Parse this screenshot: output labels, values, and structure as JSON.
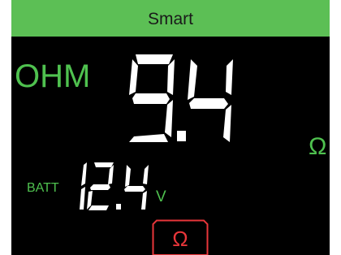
{
  "header": {
    "title": "Smart"
  },
  "display": {
    "mode_label": "OHM",
    "main_reading": {
      "integer": "9",
      "decimal": "4",
      "text": "9.4"
    },
    "main_unit": "Ω",
    "battery": {
      "label": "BATT",
      "reading": {
        "integer": "12",
        "decimal": "4",
        "text": "12.4"
      },
      "unit": "V"
    }
  },
  "controls": {
    "ohm_button_label": "Ω"
  },
  "colors": {
    "header_bg": "#5cbf55",
    "screen_bg": "#000000",
    "accent_green": "#4fc14f",
    "digits": "#ffffff",
    "ohm_button": "#e8363a"
  },
  "icons": {
    "ohm_button_icon": "omega-symbol"
  }
}
